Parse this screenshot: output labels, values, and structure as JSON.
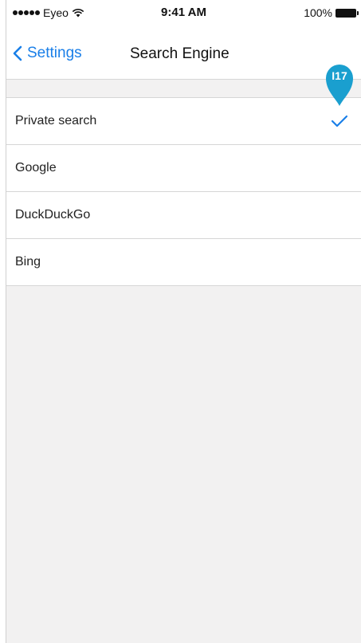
{
  "status_bar": {
    "carrier": "Eyeo",
    "time": "9:41 AM",
    "battery": "100%"
  },
  "nav": {
    "back_label": "Settings",
    "title": "Search Engine"
  },
  "engines": [
    {
      "label": "Private search",
      "selected": true
    },
    {
      "label": "Google",
      "selected": false
    },
    {
      "label": "DuckDuckGo",
      "selected": false
    },
    {
      "label": "Bing",
      "selected": false
    }
  ],
  "annotation": {
    "label": "I17",
    "color": "#1a9fcf"
  },
  "colors": {
    "accent": "#1a7fe8",
    "background": "#f2f1f1"
  },
  "icons": {
    "back": "chevron-left-icon",
    "selected": "checkmark-icon",
    "wifi": "wifi-icon",
    "battery": "battery-icon"
  }
}
